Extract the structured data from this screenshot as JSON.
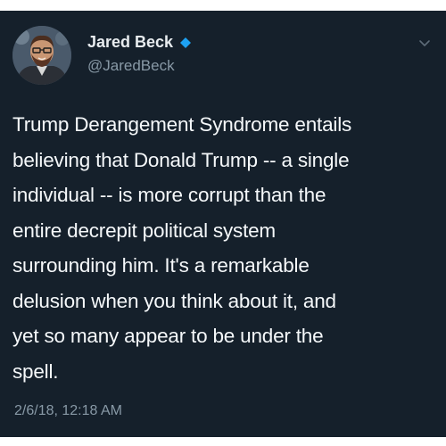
{
  "tweet": {
    "author": {
      "display_name": "Jared Beck",
      "handle": "@JaredBeck",
      "verified_icon": "verified-badge-icon"
    },
    "menu_icon": "chevron-down-icon",
    "text_lines": [
      "Trump Derangement Syndrome entails",
      "believing that Donald Trump -- a single",
      "individual -- is more corrupt than the",
      "entire decrepit political system",
      "surrounding him. It's a remarkable",
      "delusion when you think about it, and",
      "yet so many appear to be under the",
      "spell."
    ],
    "timestamp": "2/6/18, 12:18 AM"
  },
  "colors": {
    "background": "#15202b",
    "text": "#f5f8fa",
    "muted": "#8899a6",
    "verified": "#1da1f2"
  }
}
